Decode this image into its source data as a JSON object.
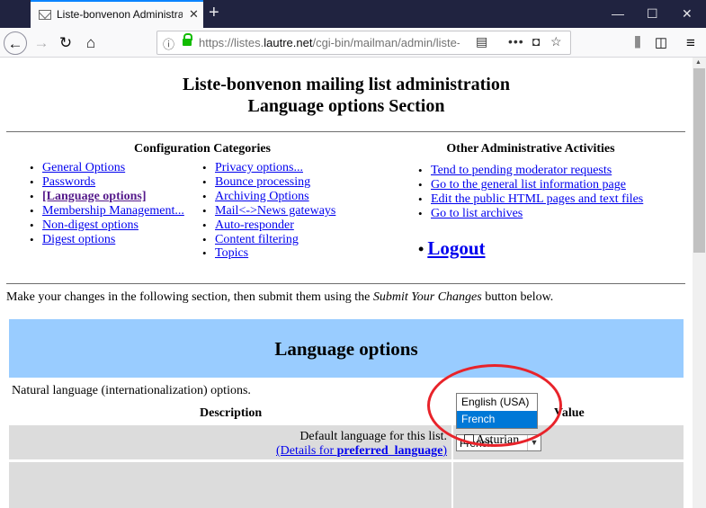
{
  "browser": {
    "tab_title": "Liste-bonvenon Administration",
    "tab_close": "✕",
    "new_tab": "+",
    "url_prefix": "https://listes.",
    "url_domain": "lautre.net",
    "url_path": "/cgi-bin/mailman/admin/liste-l",
    "window_minimize": "—",
    "window_maximize": "☐",
    "window_close": "✕",
    "icons": [
      "back-icon",
      "forward-icon",
      "reload-icon",
      "home-icon",
      "info-icon",
      "lock-icon",
      "reader-view-icon",
      "page-actions-icon",
      "pocket-icon",
      "bookmark-star-icon",
      "library-icon",
      "sidebar-icon",
      "menu-icon"
    ]
  },
  "page": {
    "title_line1": "Liste-bonvenon mailing list administration",
    "title_line2": "Language options Section",
    "config_heading": "Configuration Categories",
    "config_col1": [
      "General Options",
      "Passwords",
      "[Language options]",
      "Membership Management...",
      "Non-digest options",
      "Digest options"
    ],
    "config_col2": [
      "Privacy options...",
      "Bounce processing",
      "Archiving Options",
      "Mail<->News gateways",
      "Auto-responder",
      "Content filtering",
      "Topics"
    ],
    "other_heading": "Other Administrative Activities",
    "other_links": [
      "Tend to pending moderator requests",
      "Go to the general list information page",
      "Edit the public HTML pages and text files",
      "Go to list archives"
    ],
    "logout": "Logout",
    "intro_before": "Make your changes in the following section, then submit them using the ",
    "intro_em": "Submit Your Changes",
    "intro_after": " button below.",
    "section_title": "Language options",
    "section_desc": "Natural language (internationalization) options.",
    "col_description": "Description",
    "col_value": "Value",
    "pref_label": "Default language for this list.",
    "pref_details_prefix": "(Details for ",
    "pref_details_var": "preferred_language",
    "pref_details_suffix": ")",
    "select_value": "French",
    "dropdown_options": [
      "English (USA)",
      "French"
    ],
    "checkbox_label": "Asturian"
  },
  "colors": {
    "link": "#0000ee",
    "visited": "#551a8b",
    "section_band": "#99ccff",
    "table_cell": "#dcdcdc",
    "dropdown_selected": "#0078d7",
    "annotation_circle": "#e8232a"
  }
}
